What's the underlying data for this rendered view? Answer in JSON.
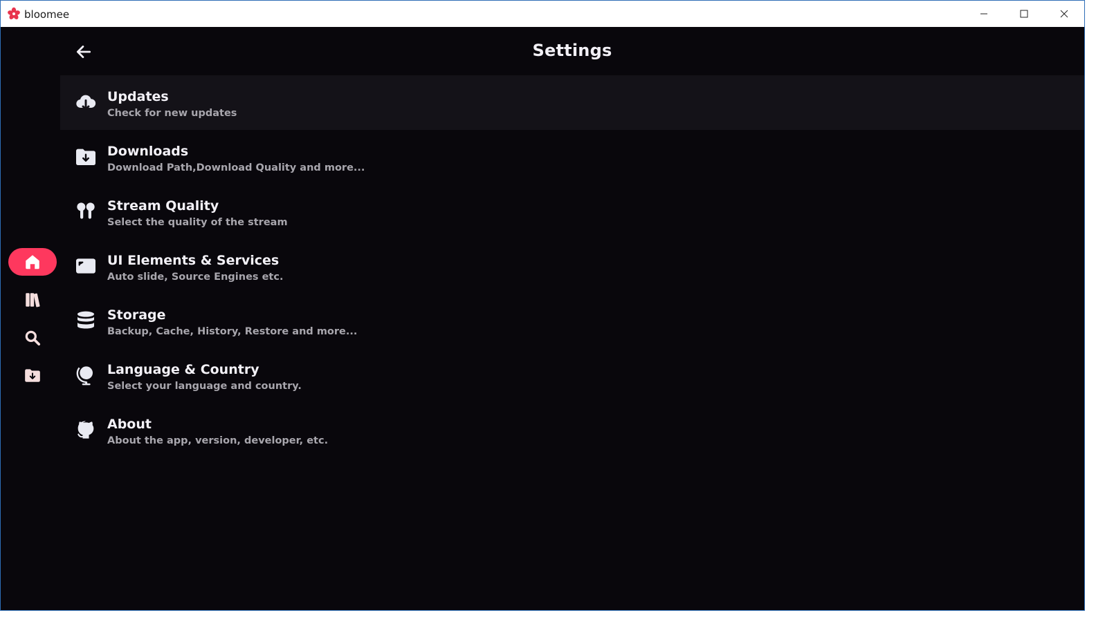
{
  "window": {
    "title": "bloomee",
    "accent": "#fe385e",
    "background": "#09070c"
  },
  "header": {
    "title": "Settings"
  },
  "nav_rail": {
    "items": [
      {
        "name": "home",
        "icon": "home-icon",
        "active": true
      },
      {
        "name": "library",
        "icon": "library-icon",
        "active": false
      },
      {
        "name": "search",
        "icon": "search-icon",
        "active": false
      },
      {
        "name": "offline",
        "icon": "download-folder-icon",
        "active": false
      }
    ]
  },
  "settings": {
    "items": [
      {
        "title": "Updates",
        "subtitle": "Check for new updates",
        "icon": "cloud-download-icon"
      },
      {
        "title": "Downloads",
        "subtitle": "Download Path,Download Quality and more...",
        "icon": "folder-download-icon"
      },
      {
        "title": "Stream Quality",
        "subtitle": "Select the quality of the stream",
        "icon": "earbuds-icon"
      },
      {
        "title": "UI Elements & Services",
        "subtitle": "Auto slide, Source Engines etc.",
        "icon": "ui-icon"
      },
      {
        "title": "Storage",
        "subtitle": "Backup, Cache, History, Restore and more...",
        "icon": "database-icon"
      },
      {
        "title": "Language & Country",
        "subtitle": "Select your language and country.",
        "icon": "globe-icon"
      },
      {
        "title": "About",
        "subtitle": "About the app, version, developer, etc.",
        "icon": "github-icon"
      }
    ]
  }
}
